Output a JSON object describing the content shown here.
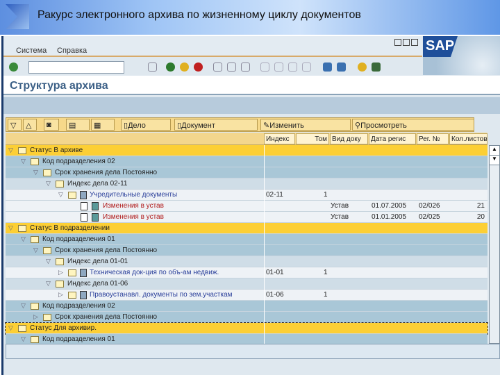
{
  "slide_title": "Ракурс электронного архива по жизненному циклу документов",
  "menu": [
    "Система",
    "Справка"
  ],
  "brand": "SAP",
  "command_field": {
    "value": ""
  },
  "screen_title": "Структура архива",
  "tree_toolbar": {
    "delo": "Дело",
    "document": "Документ",
    "change": "Изменить",
    "view": "Просмотреть"
  },
  "columns": [
    "Индекс",
    "Том",
    "Вид доку",
    "Дата регис",
    "Рег. №",
    "Кол.листов"
  ],
  "rows": [
    {
      "style": "y",
      "level": 0,
      "exp": "▽",
      "kind": "folder",
      "label": "Статус В архиве"
    },
    {
      "style": "b",
      "level": 1,
      "exp": "▽",
      "kind": "folder",
      "label": "Код подразделения 02"
    },
    {
      "style": "b",
      "level": 2,
      "exp": "▽",
      "kind": "folder",
      "label": "Срок хранения дела Постоянно"
    },
    {
      "style": "l",
      "level": 3,
      "exp": "▽",
      "kind": "folder",
      "label": "Индекс дела 02-11"
    },
    {
      "style": "w",
      "level": 4,
      "exp": "▽",
      "kind": "case",
      "label": "Учредительные документы",
      "color": "#2a3f9a",
      "cells": [
        "02-11",
        "1",
        "",
        "",
        "",
        ""
      ]
    },
    {
      "style": "w",
      "level": 5,
      "exp": "",
      "kind": "doc",
      "label": "Изменения в устав",
      "color": "#b01818",
      "cells": [
        "",
        "",
        "Устав",
        "01.07.2005",
        "02/026",
        "21"
      ]
    },
    {
      "style": "w",
      "level": 5,
      "exp": "",
      "kind": "doc",
      "label": "Изменения в устав",
      "color": "#b01818",
      "cells": [
        "",
        "",
        "Устав",
        "01.01.2005",
        "02/025",
        "20"
      ]
    },
    {
      "style": "y",
      "level": 0,
      "exp": "▽",
      "kind": "folder",
      "label": "Статус В подразделении"
    },
    {
      "style": "b",
      "level": 1,
      "exp": "▽",
      "kind": "folder",
      "label": "Код подразделения 01"
    },
    {
      "style": "b",
      "level": 2,
      "exp": "▽",
      "kind": "folder",
      "label": "Срок хранения дела Постоянно"
    },
    {
      "style": "l",
      "level": 3,
      "exp": "▽",
      "kind": "folder",
      "label": "Индекс дела 01-01"
    },
    {
      "style": "w",
      "level": 4,
      "exp": "▷",
      "kind": "case",
      "label": "Техническая док-ция по объ-ам недвиж.",
      "color": "#2a3f9a",
      "cells": [
        "01-01",
        "1",
        "",
        "",
        "",
        ""
      ]
    },
    {
      "style": "l",
      "level": 3,
      "exp": "▽",
      "kind": "folder",
      "label": "Индекс дела 01-06"
    },
    {
      "style": "w",
      "level": 4,
      "exp": "▷",
      "kind": "case",
      "label": "Правоустанавл. документы по зем.участкам",
      "color": "#2a3f9a",
      "cells": [
        "01-06",
        "1",
        "",
        "",
        "",
        ""
      ]
    },
    {
      "style": "b",
      "level": 1,
      "exp": "▽",
      "kind": "folder",
      "label": "Код подразделения 02"
    },
    {
      "style": "b",
      "level": 2,
      "exp": "▷",
      "kind": "folder",
      "label": "Срок хранения дела Постоянно"
    },
    {
      "style": "y",
      "level": 0,
      "exp": "▽",
      "kind": "folder",
      "label": "Статус Для архивир.",
      "selected": true
    },
    {
      "style": "b",
      "level": 1,
      "exp": "▽",
      "kind": "folder",
      "label": "Код подразделения 01"
    }
  ]
}
